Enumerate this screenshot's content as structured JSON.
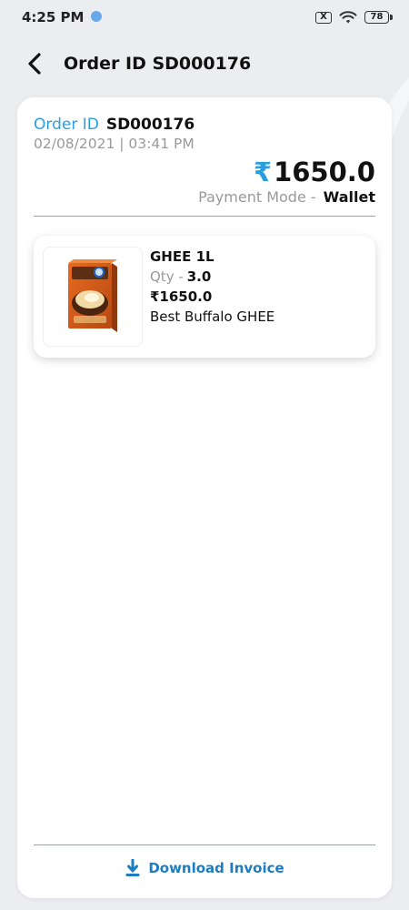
{
  "status_bar": {
    "time": "4:25 PM",
    "sim_icon_text": "X",
    "battery": "78"
  },
  "header": {
    "title": "Order ID SD000176"
  },
  "order": {
    "id_label": "Order ID",
    "id_value": "SD000176",
    "datetime": "02/08/2021 | 03:41 PM",
    "currency_symbol": "₹",
    "total": "1650.0",
    "payment_mode_label": "Payment Mode -",
    "payment_mode_value": "Wallet"
  },
  "items": [
    {
      "name": "GHEE 1L",
      "qty_label": "Qty -",
      "qty_value": "3.0",
      "price": "₹1650.0",
      "description": "Best Buffalo GHEE"
    }
  ],
  "actions": {
    "download_invoice": "Download Invoice"
  },
  "icons": {
    "back": "back-arrow-icon",
    "download": "download-icon",
    "wifi": "wifi-icon",
    "battery": "battery-icon",
    "sim": "sim-x-icon"
  },
  "colors": {
    "accent": "#2a9fe0",
    "link": "#1e7cc1"
  }
}
